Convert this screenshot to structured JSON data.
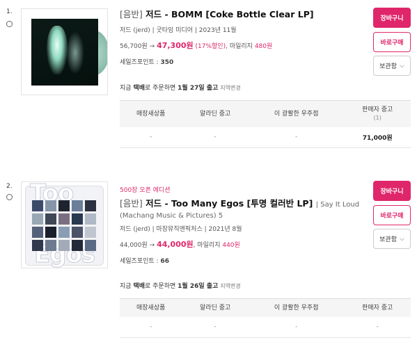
{
  "items": [
    {
      "index": "1.",
      "category": "[음반]",
      "title": "저드 - BOMM [Coke Bottle Clear LP]",
      "meta": "저드 (jerd) | 굿타임 미디어 | 2023년 11월",
      "price_original": "56,700원 →",
      "price_sale": "47,300원",
      "discount_text": "(17%할인)",
      "mileage_label": ", 마일리지",
      "mileage_value": "480원",
      "points_label": "세일즈포인트 :",
      "points_value": "350",
      "ship_prefix": "지금",
      "ship_method": "택배",
      "ship_middle": "로 주문하면",
      "ship_date": "1월 27일 출고",
      "ship_region": "지역변경",
      "buttons": {
        "cart": "장바구니",
        "buy": "바로구매",
        "keep": "보관함"
      },
      "stock_headers": [
        "매장새상품",
        "알라딘 중고",
        "이 광활한 우주점",
        "판매자 중고"
      ],
      "stock_header_sub": "(1)",
      "stock_values": [
        "-",
        "-",
        "-",
        "71,000원"
      ]
    },
    {
      "index": "2.",
      "edition": "500장 오픈 에디션",
      "category": "[음반]",
      "title": "저드 - Too Many Egos [투명 컬러반 LP]",
      "sub_link": "| Say It Loud",
      "sub_line2": "(Machang Music & Pictures) 5",
      "meta": "저드 (jerd) | 마장뮤직앤픽처스 | 2021년 8월",
      "price_original": "44,000원 →",
      "price_sale": "44,000원",
      "mileage_label": ", 마일리지",
      "mileage_value": "440원",
      "points_label": "세일즈포인트 :",
      "points_value": "66",
      "ship_prefix": "지금",
      "ship_method": "택배",
      "ship_middle": "로 주문하면",
      "ship_date": "1월 26일 출고",
      "ship_region": "지역변경",
      "buttons": {
        "cart": "장바구니",
        "buy": "바로구매",
        "keep": "보관함"
      },
      "stock_headers": [
        "매장새상품",
        "알라딘 중고",
        "이 광활한 우주점",
        "판매자 중고"
      ],
      "stock_values": [
        "-",
        "-",
        "-",
        "-"
      ]
    }
  ],
  "icons": {
    "keep_dropdown": "chevron-down-icon",
    "select": "radio-circle-icon"
  },
  "colors": {
    "accent": "#e0266a",
    "header_bg": "#f5f5f5"
  },
  "cover2_text": [
    "Too",
    "Egos"
  ]
}
